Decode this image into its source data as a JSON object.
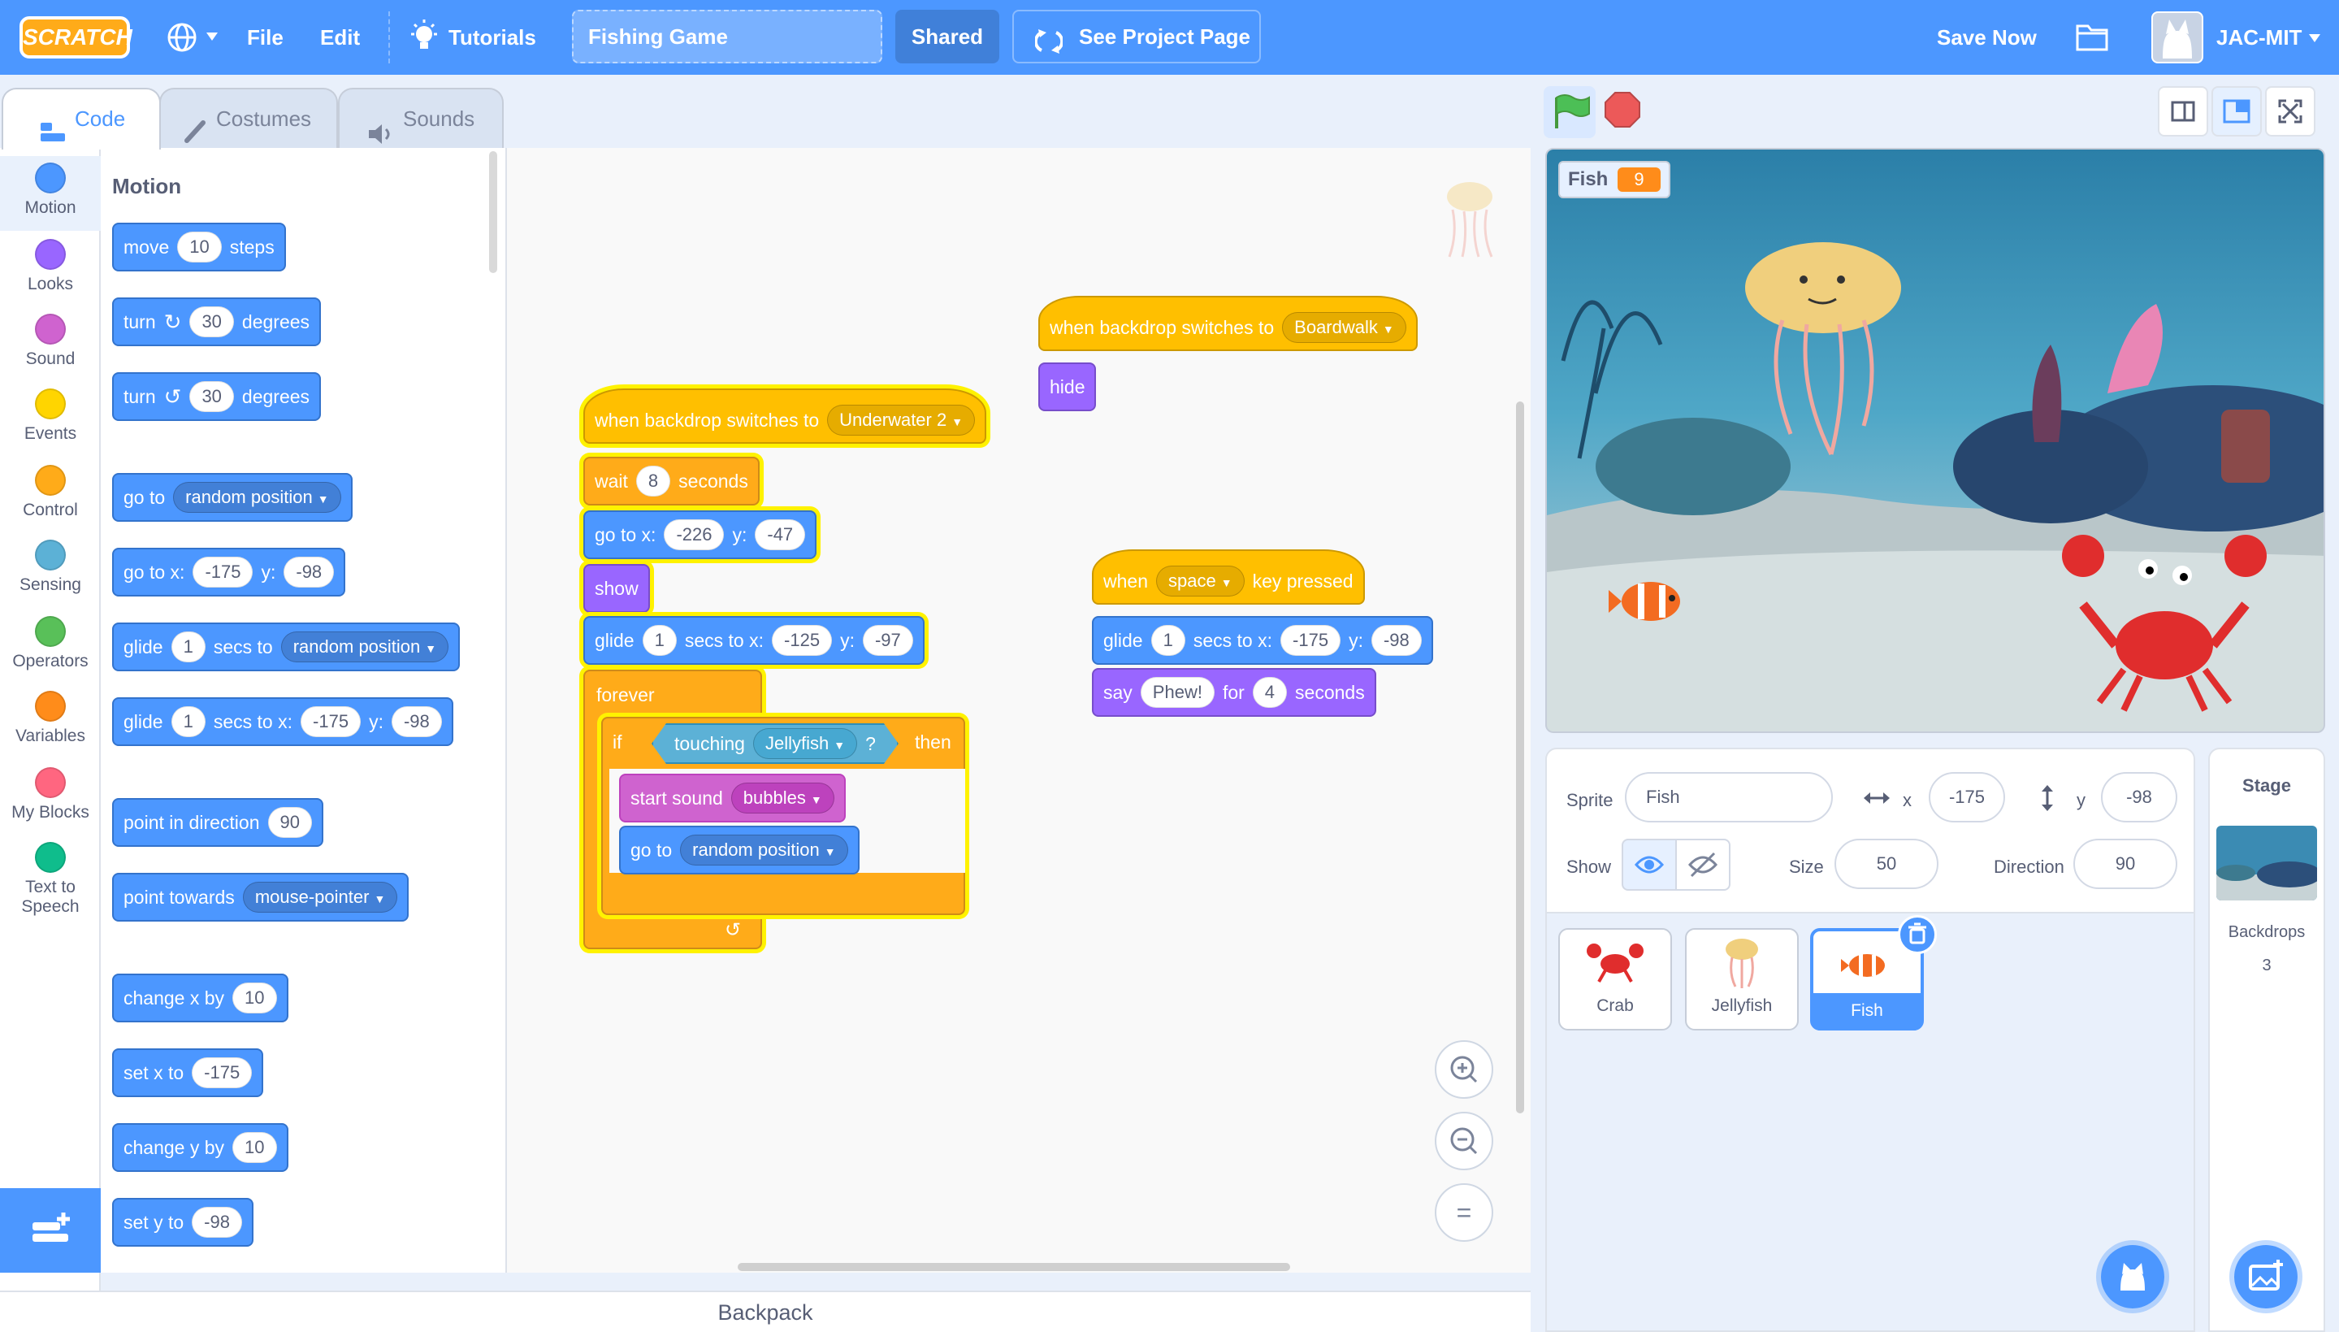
{
  "menubar": {
    "logo": "SCRATCH",
    "file": "File",
    "edit": "Edit",
    "tutorials": "Tutorials",
    "project_title": "Fishing Game",
    "shared": "Shared",
    "see_project": "See Project Page",
    "save_now": "Save Now",
    "username": "JAC-MIT",
    "icons": [
      "globe-icon",
      "chevron-down-icon",
      "lightbulb-icon",
      "remix-icon",
      "folder-icon"
    ]
  },
  "tabs": [
    {
      "label": "Code",
      "icon": "code-icon",
      "active": true
    },
    {
      "label": "Costumes",
      "icon": "brush-icon",
      "active": false
    },
    {
      "label": "Sounds",
      "icon": "speaker-icon",
      "active": false
    }
  ],
  "categories": [
    {
      "label": "Motion",
      "color": "#4c97ff"
    },
    {
      "label": "Looks",
      "color": "#9966ff"
    },
    {
      "label": "Sound",
      "color": "#cf63cf"
    },
    {
      "label": "Events",
      "color": "#ffd500"
    },
    {
      "label": "Control",
      "color": "#ffab19"
    },
    {
      "label": "Sensing",
      "color": "#5cb1d6"
    },
    {
      "label": "Operators",
      "color": "#59c059"
    },
    {
      "label": "Variables",
      "color": "#ff8c1a"
    },
    {
      "label": "My Blocks",
      "color": "#ff6680"
    },
    {
      "label": "Text to Speech",
      "color": "#0fbd8c"
    }
  ],
  "palette": {
    "title": "Motion",
    "blocks": [
      {
        "parts": [
          "move",
          "#10",
          "steps"
        ]
      },
      {
        "parts": [
          "turn",
          "@cw",
          "#30",
          "degrees"
        ]
      },
      {
        "parts": [
          "turn",
          "@ccw",
          "#30",
          "degrees"
        ]
      },
      {
        "parts": [
          "go to",
          "~random position"
        ]
      },
      {
        "parts": [
          "go to x:",
          "#-175",
          "y:",
          "#-98"
        ]
      },
      {
        "parts": [
          "glide",
          "#1",
          "secs to",
          "~random position"
        ]
      },
      {
        "parts": [
          "glide",
          "#1",
          "secs to x:",
          "#-175",
          "y:",
          "#-98"
        ]
      },
      {
        "parts": [
          "point in direction",
          "#90"
        ]
      },
      {
        "parts": [
          "point towards",
          "~mouse-pointer"
        ]
      },
      {
        "parts": [
          "change x by",
          "#10"
        ]
      },
      {
        "parts": [
          "set x to",
          "#-175"
        ]
      },
      {
        "parts": [
          "change y by",
          "#10"
        ]
      },
      {
        "parts": [
          "set y to",
          "#-98"
        ]
      }
    ]
  },
  "scripts": {
    "script1": {
      "hat": {
        "text": "when backdrop switches to",
        "dropdown": "Underwater 2"
      },
      "wait": {
        "a": "wait",
        "v": "8",
        "b": "seconds"
      },
      "goto": {
        "a": "go to x:",
        "x": "-226",
        "b": "y:",
        "y": "-47"
      },
      "show": "show",
      "glide": {
        "a": "glide",
        "v": "1",
        "b": "secs to x:",
        "x": "-125",
        "c": "y:",
        "y": "-97"
      },
      "forever": "forever",
      "if": {
        "a": "if",
        "then": "then"
      },
      "touching": {
        "a": "touching",
        "dropdown": "Jellyfish",
        "q": "?"
      },
      "sound": {
        "a": "start sound",
        "dropdown": "bubbles"
      },
      "goto_random": {
        "a": "go to",
        "dropdown": "random position"
      }
    },
    "script2": {
      "hat": {
        "text": "when backdrop switches to",
        "dropdown": "Boardwalk"
      },
      "hide": "hide"
    },
    "script3": {
      "hat": {
        "a": "when",
        "dropdown": "space",
        "b": "key pressed"
      },
      "glide": {
        "a": "glide",
        "v": "1",
        "b": "secs to x:",
        "x": "-175",
        "c": "y:",
        "y": "-98"
      },
      "say": {
        "a": "say",
        "msg": "Phew!",
        "b": "for",
        "v": "4",
        "c": "seconds"
      }
    }
  },
  "zoom": {
    "in": "+",
    "out": "−",
    "reset": "="
  },
  "backpack": "Backpack",
  "stage": {
    "monitor_label": "Fish",
    "monitor_value": "9"
  },
  "sprite_info": {
    "sprite_label": "Sprite",
    "sprite_name": "Fish",
    "x_label": "x",
    "x_value": "-175",
    "y_label": "y",
    "y_value": "-98",
    "show_label": "Show",
    "size_label": "Size",
    "size_value": "50",
    "direction_label": "Direction",
    "direction_value": "90"
  },
  "sprites": [
    {
      "name": "Crab",
      "selected": false
    },
    {
      "name": "Jellyfish",
      "selected": false
    },
    {
      "name": "Fish",
      "selected": true
    }
  ],
  "stage_pane": {
    "title": "Stage",
    "backdrops_label": "Backdrops",
    "backdrops_count": "3"
  }
}
